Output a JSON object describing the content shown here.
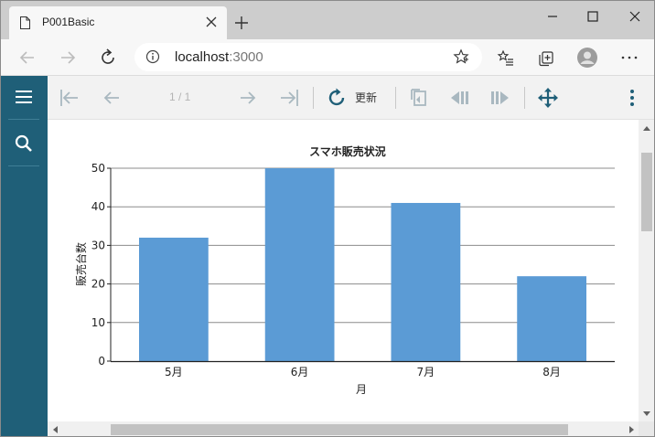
{
  "browser": {
    "tab_title": "P001Basic",
    "url_host": "localhost",
    "url_port": ":3000"
  },
  "viewer": {
    "page_indicator": "1 / 1",
    "refresh_label": "更新"
  },
  "colors": {
    "sidebar": "#1f5f78",
    "bar": "#5b9bd5",
    "toolbar_icon": "#a9b8c0",
    "toolbar_icon_active": "#1f5f78"
  },
  "chart_data": {
    "type": "bar",
    "title": "スマホ販売状況",
    "xlabel": "月",
    "ylabel": "販売台数",
    "categories": [
      "5月",
      "6月",
      "7月",
      "8月"
    ],
    "values": [
      32,
      50,
      41,
      22
    ],
    "ylim": [
      0,
      50
    ],
    "yticks": [
      "0",
      "10",
      "20",
      "30",
      "40",
      "50"
    ],
    "grid": true
  }
}
